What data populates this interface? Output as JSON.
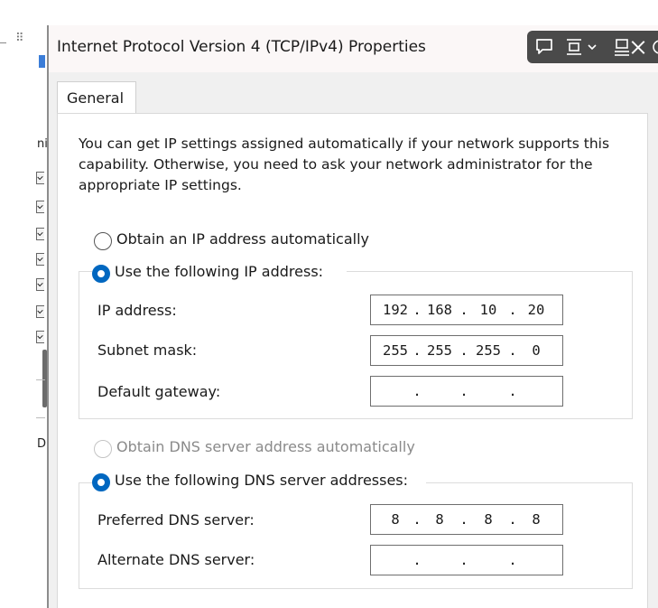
{
  "window": {
    "title": "Internet Protocol Version 4 (TCP/IPv4) Properties"
  },
  "toolbar": {
    "icons": [
      "comment-icon",
      "frame-icon",
      "chevron-down-icon",
      "pin-icon",
      "close-icon",
      "power-icon"
    ]
  },
  "background_app": {
    "letters": [
      "ni",
      "D"
    ]
  },
  "tabs": [
    {
      "label": "General",
      "selected": true
    }
  ],
  "intro_text": "You can get IP settings assigned automatically if your network supports this capability. Otherwise, you need to ask your network administrator for the appropriate IP settings.",
  "ip_section": {
    "auto_option": {
      "label": "Obtain an IP address automatically",
      "selected": false
    },
    "manual_option": {
      "label": "Use the following IP address:",
      "selected": true
    },
    "fields": [
      {
        "label": "IP address:",
        "octets": [
          "192",
          "168",
          "10",
          "20"
        ]
      },
      {
        "label": "Subnet mask:",
        "octets": [
          "255",
          "255",
          "255",
          "0"
        ]
      },
      {
        "label": "Default gateway:",
        "octets": [
          "",
          "",
          "",
          ""
        ]
      }
    ]
  },
  "dns_section": {
    "auto_option": {
      "label": "Obtain DNS server address automatically",
      "selected": false,
      "disabled": true
    },
    "manual_option": {
      "label": "Use the following DNS server addresses:",
      "selected": true
    },
    "fields": [
      {
        "label": "Preferred DNS server:",
        "octets": [
          "8",
          "8",
          "8",
          "8"
        ]
      },
      {
        "label": "Alternate DNS server:",
        "octets": [
          "",
          "",
          "",
          ""
        ]
      }
    ]
  },
  "separator": ".",
  "colors": {
    "accent": "#0067c0",
    "toolbar_bg": "#4a4a4a",
    "dialog_bg": "#f0f0f0",
    "panel_bg": "#ffffff"
  }
}
